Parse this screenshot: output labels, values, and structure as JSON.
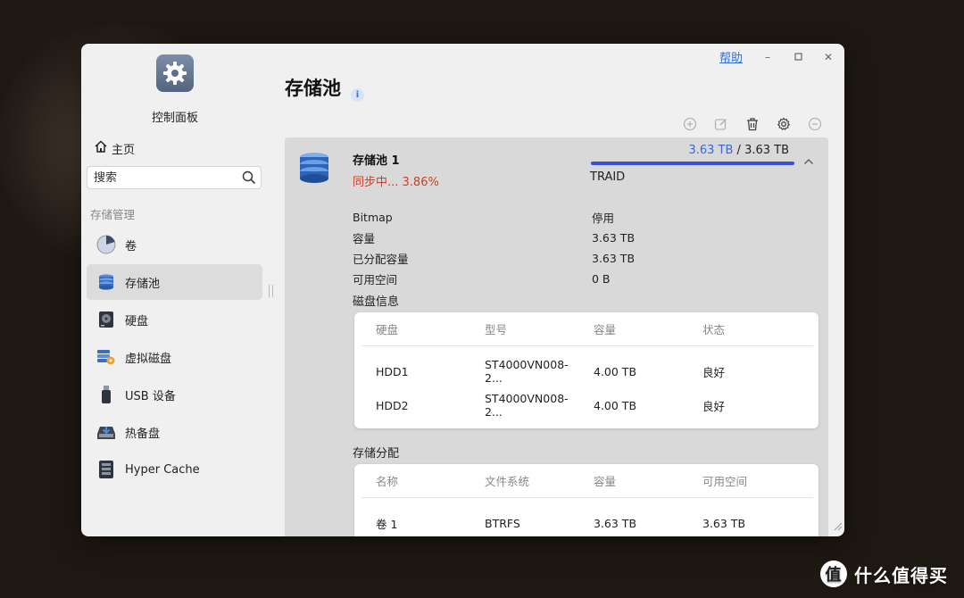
{
  "window": {
    "help_label": "帮助",
    "minimize_icon": "minimize-icon",
    "maximize_icon": "maximize-icon",
    "close_icon": "close-icon"
  },
  "sidebar": {
    "app_icon": "gear-icon",
    "app_title": "控制面板",
    "home_label": "主页",
    "search_placeholder": "搜索",
    "section_label": "存储管理",
    "items": [
      {
        "label": "卷",
        "icon": "pie-icon",
        "active": false
      },
      {
        "label": "存储池",
        "icon": "database-icon",
        "active": true
      },
      {
        "label": "硬盘",
        "icon": "hdd-icon",
        "active": false
      },
      {
        "label": "虚拟磁盘",
        "icon": "virtual-disk-icon",
        "active": false
      },
      {
        "label": "USB 设备",
        "icon": "usb-icon",
        "active": false
      },
      {
        "label": "热备盘",
        "icon": "hot-spare-icon",
        "active": false
      },
      {
        "label": "Hyper Cache",
        "icon": "cache-icon",
        "active": false
      }
    ]
  },
  "main": {
    "title": "存储池",
    "info_glyph": "i",
    "toolbar": [
      "add-icon",
      "edit-icon",
      "delete-icon",
      "settings-icon",
      "remove-icon"
    ],
    "pool": {
      "name": "存储池 1",
      "status": "同步中... 3.86%",
      "used": "3.63 TB",
      "separator": " / ",
      "total": "3.63 TB",
      "usage_fraction": 1.0,
      "raid": "TRAID",
      "properties": [
        {
          "key": "Bitmap",
          "value": "停用"
        },
        {
          "key": "容量",
          "value": "3.63 TB"
        },
        {
          "key": "已分配容量",
          "value": "3.63 TB"
        },
        {
          "key": "可用空间",
          "value": "0 B"
        }
      ],
      "disk_info_title": "磁盘信息",
      "disk_table": {
        "headers": [
          "硬盘",
          "型号",
          "容量",
          "状态"
        ],
        "rows": [
          [
            "HDD1",
            "ST4000VN008-2...",
            "4.00 TB",
            "良好"
          ],
          [
            "HDD2",
            "ST4000VN008-2...",
            "4.00 TB",
            "良好"
          ]
        ]
      },
      "alloc_title": "存储分配",
      "alloc_table": {
        "headers": [
          "名称",
          "文件系统",
          "容量",
          "可用空间"
        ],
        "rows": [
          [
            "卷 1",
            "BTRFS",
            "3.63 TB",
            "3.63 TB"
          ]
        ]
      }
    }
  },
  "watermark": {
    "logo_glyph": "值",
    "text": "什么值得买"
  },
  "colors": {
    "accent": "#3d66d6",
    "status_syncing": "#c9402a",
    "active_nav": "#dcdcdc"
  }
}
